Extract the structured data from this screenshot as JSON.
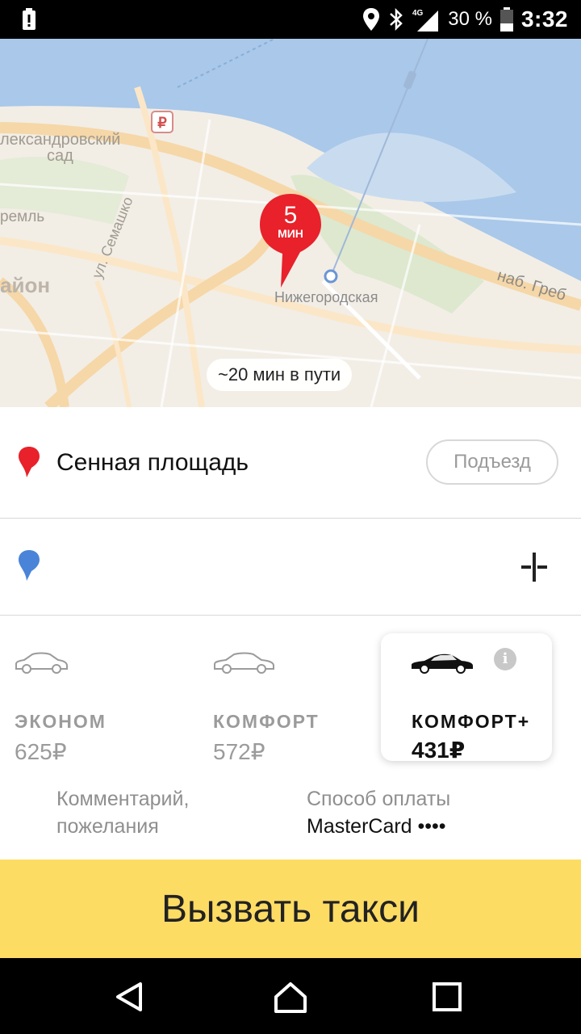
{
  "status_bar": {
    "battery_percent": "30 %",
    "time": "3:32",
    "network": "4G",
    "icons": [
      "alert-icon",
      "location-icon",
      "bluetooth-icon",
      "signal-icon",
      "battery-icon"
    ]
  },
  "map": {
    "pin_eta": "5",
    "pin_unit": "МИН",
    "station_label": "Нижегородская",
    "trip_time": "~20 мин в пути",
    "labels": {
      "garden_line1": "лександровский",
      "garden_line2": "сад",
      "kremlin": "ремль",
      "district": "айон",
      "street_semashko": "ул. Семашко",
      "embankment": "наб. Греб"
    },
    "parking_symbol": "₽"
  },
  "route": {
    "from_address": "Сенная площадь",
    "entrance_label": "Подъезд",
    "to_address": ""
  },
  "tariffs": [
    {
      "name": "ЭКОНОМ",
      "price": "625₽",
      "selected": false
    },
    {
      "name": "КОМФОРТ",
      "price": "572₽",
      "selected": false
    },
    {
      "name": "КОМФОРТ+",
      "price": "431₽",
      "selected": true
    }
  ],
  "tariff_info_symbol": "i",
  "options": {
    "comment_label": "Комментарий, пожелания",
    "payment_label": "Способ оплаты",
    "payment_value": "MasterCard ••••"
  },
  "call_button_label": "Вызвать такси",
  "colors": {
    "accent_yellow": "#fddc64",
    "pin_red": "#e8212a",
    "destination_blue": "#4a84d8",
    "water": "#a9c8ea",
    "park": "#dde8cf"
  }
}
